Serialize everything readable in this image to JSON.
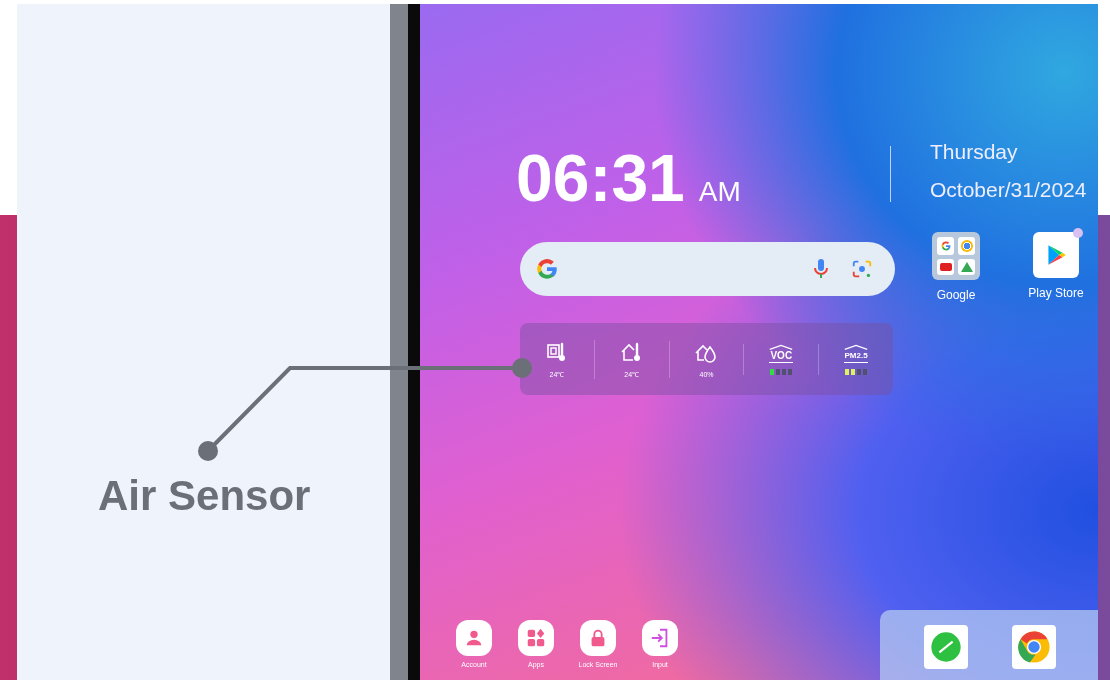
{
  "clock": {
    "time": "06:31",
    "period": "AM"
  },
  "date": {
    "weekday": "Thursday",
    "date": "October/31/2024"
  },
  "apps": [
    {
      "label": "Google",
      "kind": "folder"
    },
    {
      "label": "Play Store",
      "kind": "store"
    }
  ],
  "sensors": [
    {
      "kind": "chip-temp",
      "reading": "24℃"
    },
    {
      "kind": "room-temp",
      "reading": "24℃"
    },
    {
      "kind": "humidity",
      "reading": "40%"
    },
    {
      "kind": "voc",
      "label": "VOC",
      "level": 0.25,
      "color": "#30e040"
    },
    {
      "kind": "pm",
      "label": "PM2.5",
      "level": 0.5,
      "color": "#e0f060"
    }
  ],
  "dock": [
    {
      "label": "Account",
      "kind": "account"
    },
    {
      "label": "Apps",
      "kind": "apps"
    },
    {
      "label": "Lock Screen",
      "kind": "lock"
    },
    {
      "label": "Input",
      "kind": "input"
    }
  ],
  "tray": [
    {
      "kind": "note"
    },
    {
      "kind": "browser"
    }
  ],
  "callout": {
    "label": "Air Sensor"
  }
}
